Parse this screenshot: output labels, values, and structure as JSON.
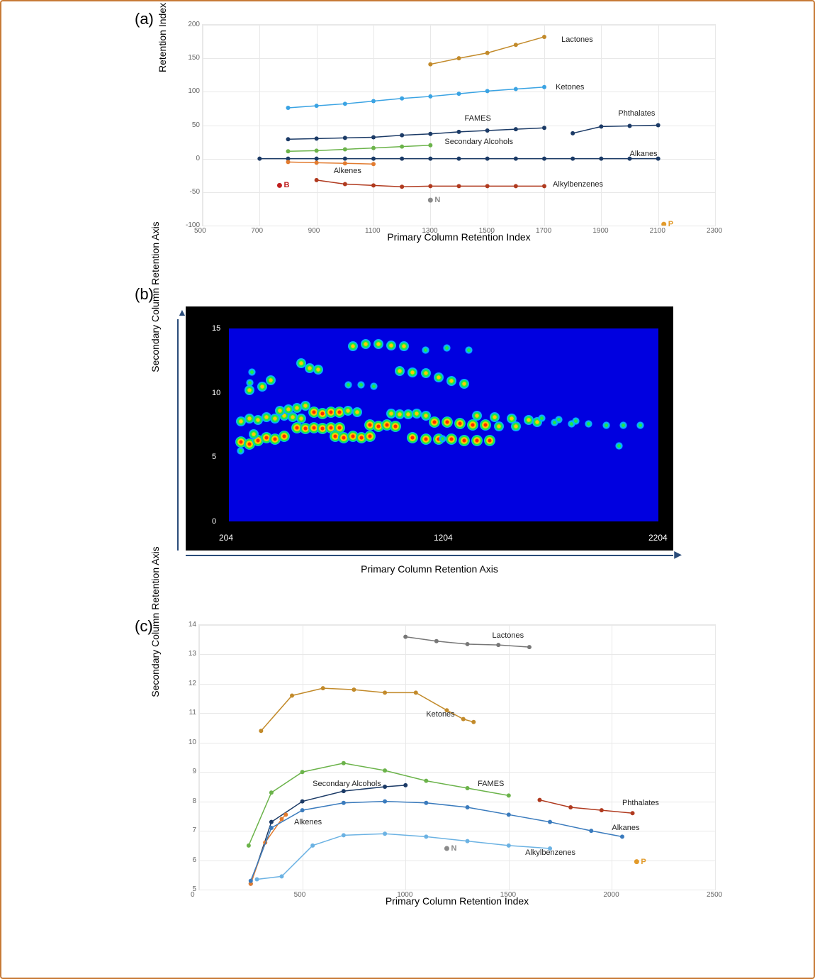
{
  "panel_labels": {
    "a": "(a)",
    "b": "(b)",
    "c": "(c)"
  },
  "axes": {
    "a_x": "Primary Column Retention Index",
    "a_y": "Retention Index Difference (ΔI)",
    "b_x": "Primary Column Retention Axis",
    "b_y": "Secondary Column Retention Axis",
    "c_x": "Primary Column Retention Index",
    "c_y": "Secondary Column Retention Axis"
  },
  "series_names": {
    "lactones": "Lactones",
    "ketones": "Ketones",
    "fames": "FAMES",
    "phthalates": "Phthalates",
    "sec_alc": "Secondary Alcohols",
    "alkanes": "Alkanes",
    "alkenes": "Alkenes",
    "alkylbenz": "Alkylbenzenes"
  },
  "markers": {
    "B": "B",
    "N": "N",
    "P": "P"
  },
  "colors": {
    "lactones": "#c28a2a",
    "ketones": "#3aa3e3",
    "fames": "#1b3a66",
    "phthalates": "#1b3a66",
    "sec_alc": "#6bb34a",
    "alkanes": "#1b3a66",
    "alkenes": "#e27b2f",
    "alkylbenz": "#b03a1f",
    "B": "#c02020",
    "N": "#8a8a8a",
    "P": "#e29a2a",
    "c_lactones": "#777",
    "c_ketones": "#c28a2a",
    "c_fames": "#6bb34a",
    "c_sec_alc": "#1b3a66",
    "c_alkenes": "#e27b2f",
    "c_alkanes": "#3a7bbd",
    "c_alkylbenz": "#6bb2e3",
    "c_phthalates": "#b03a1f"
  },
  "chart_data": [
    {
      "id": "a",
      "type": "line",
      "title": "",
      "xlabel": "Primary Column Retention Index",
      "ylabel": "Retention Index Difference (ΔI)",
      "xlim": [
        500,
        2300
      ],
      "ylim": [
        -100,
        200
      ],
      "xticks": [
        500,
        700,
        900,
        1100,
        1300,
        1500,
        1700,
        1900,
        2100,
        2300
      ],
      "yticks": [
        -100,
        -50,
        0,
        50,
        100,
        150,
        200
      ],
      "series": [
        {
          "name": "Lactones",
          "color": "#c28a2a",
          "x": [
            1300,
            1400,
            1500,
            1600,
            1700
          ],
          "y": [
            141,
            150,
            158,
            170,
            182
          ]
        },
        {
          "name": "Ketones",
          "color": "#3aa3e3",
          "x": [
            800,
            900,
            1000,
            1100,
            1200,
            1300,
            1400,
            1500,
            1600,
            1700
          ],
          "y": [
            76,
            79,
            82,
            86,
            90,
            93,
            97,
            101,
            104,
            107
          ]
        },
        {
          "name": "FAMES",
          "color": "#1b3a66",
          "x": [
            800,
            900,
            1000,
            1100,
            1200,
            1300,
            1400,
            1500,
            1600,
            1700
          ],
          "y": [
            29,
            30,
            31,
            32,
            35,
            37,
            40,
            42,
            44,
            46
          ]
        },
        {
          "name": "Phthalates",
          "color": "#1b3a66",
          "x": [
            1800,
            1900,
            2000,
            2100
          ],
          "y": [
            38,
            48,
            49,
            50
          ]
        },
        {
          "name": "Secondary Alcohols",
          "color": "#6bb34a",
          "x": [
            800,
            900,
            1000,
            1100,
            1200,
            1300
          ],
          "y": [
            11,
            12,
            14,
            16,
            18,
            20
          ]
        },
        {
          "name": "Alkanes",
          "color": "#1b3a66",
          "x": [
            700,
            800,
            900,
            1000,
            1100,
            1200,
            1300,
            1400,
            1500,
            1600,
            1700,
            1800,
            1900,
            2000,
            2100
          ],
          "y": [
            0,
            0,
            0,
            0,
            0,
            0,
            0,
            0,
            0,
            0,
            0,
            0,
            0,
            0,
            0
          ]
        },
        {
          "name": "Alkenes",
          "color": "#e27b2f",
          "x": [
            800,
            900,
            1000,
            1100
          ],
          "y": [
            -5,
            -6,
            -7,
            -8
          ]
        },
        {
          "name": "Alkylbenzenes",
          "color": "#b03a1f",
          "x": [
            900,
            1000,
            1100,
            1200,
            1300,
            1400,
            1500,
            1600,
            1700
          ],
          "y": [
            -32,
            -38,
            -40,
            -42,
            -41,
            -41,
            -41,
            -41,
            -41
          ]
        }
      ],
      "points": [
        {
          "name": "B",
          "color": "#c02020",
          "x": 770,
          "y": -40
        },
        {
          "name": "N",
          "color": "#8a8a8a",
          "x": 1300,
          "y": -62
        },
        {
          "name": "P",
          "color": "#e29a2a",
          "x": 2120,
          "y": -98
        }
      ],
      "annotations": [
        {
          "text": "Lactones",
          "x": 1760,
          "y": 176
        },
        {
          "text": "Ketones",
          "x": 1740,
          "y": 105
        },
        {
          "text": "FAMES",
          "x": 1420,
          "y": 58
        },
        {
          "text": "Phthalates",
          "x": 1960,
          "y": 65
        },
        {
          "text": "Secondary Alcohols",
          "x": 1350,
          "y": 23
        },
        {
          "text": "Alkanes",
          "x": 2000,
          "y": 5
        },
        {
          "text": "Alkenes",
          "x": 960,
          "y": -20
        },
        {
          "text": "Alkylbenzenes",
          "x": 1730,
          "y": -41
        }
      ]
    },
    {
      "id": "b",
      "type": "heatmap",
      "xlabel": "Primary Column Retention Axis",
      "ylabel": "Secondary Column Retention Axis",
      "xlim": [
        204,
        2204
      ],
      "ylim": [
        0,
        15
      ],
      "xticks": [
        204,
        1204,
        2204
      ],
      "yticks": [
        0,
        5,
        10,
        15
      ],
      "spots": [
        [
          260,
          6.2,
          1
        ],
        [
          300,
          6.0,
          1
        ],
        [
          340,
          6.3,
          1
        ],
        [
          320,
          6.8,
          2
        ],
        [
          380,
          6.5,
          1
        ],
        [
          420,
          6.4,
          1
        ],
        [
          460,
          6.6,
          1
        ],
        [
          260,
          7.8,
          2
        ],
        [
          300,
          8.0,
          2
        ],
        [
          340,
          7.9,
          2
        ],
        [
          380,
          8.1,
          2
        ],
        [
          420,
          8.0,
          2
        ],
        [
          460,
          8.2,
          2
        ],
        [
          500,
          8.1,
          2
        ],
        [
          540,
          8.0,
          2
        ],
        [
          300,
          10.2,
          2
        ],
        [
          300,
          10.8,
          3
        ],
        [
          310,
          11.6,
          3
        ],
        [
          360,
          10.5,
          2
        ],
        [
          400,
          11.0,
          2
        ],
        [
          440,
          8.6,
          2
        ],
        [
          480,
          8.7,
          2
        ],
        [
          520,
          8.8,
          2
        ],
        [
          560,
          9.0,
          2
        ],
        [
          520,
          7.3,
          1
        ],
        [
          560,
          7.2,
          1
        ],
        [
          600,
          7.3,
          1
        ],
        [
          640,
          7.2,
          1
        ],
        [
          680,
          7.3,
          1
        ],
        [
          720,
          7.3,
          1
        ],
        [
          540,
          12.3,
          2
        ],
        [
          580,
          11.9,
          2
        ],
        [
          620,
          11.8,
          2
        ],
        [
          600,
          8.5,
          1
        ],
        [
          640,
          8.4,
          1
        ],
        [
          680,
          8.5,
          1
        ],
        [
          720,
          8.5,
          1
        ],
        [
          760,
          8.6,
          2
        ],
        [
          800,
          8.5,
          2
        ],
        [
          700,
          6.6,
          1
        ],
        [
          740,
          6.5,
          1
        ],
        [
          780,
          6.6,
          1
        ],
        [
          820,
          6.5,
          1
        ],
        [
          860,
          6.6,
          1
        ],
        [
          760,
          10.6,
          3
        ],
        [
          820,
          10.6,
          3
        ],
        [
          880,
          10.5,
          3
        ],
        [
          780,
          13.6,
          2
        ],
        [
          840,
          13.8,
          2
        ],
        [
          900,
          13.8,
          2
        ],
        [
          960,
          13.7,
          2
        ],
        [
          1020,
          13.6,
          2
        ],
        [
          1120,
          13.3,
          3
        ],
        [
          1220,
          13.5,
          3
        ],
        [
          1320,
          13.3,
          3
        ],
        [
          860,
          7.5,
          1
        ],
        [
          900,
          7.4,
          1
        ],
        [
          940,
          7.5,
          1
        ],
        [
          980,
          7.4,
          1
        ],
        [
          960,
          8.4,
          2
        ],
        [
          1000,
          8.3,
          2
        ],
        [
          1040,
          8.3,
          2
        ],
        [
          1080,
          8.4,
          2
        ],
        [
          1120,
          8.2,
          2
        ],
        [
          1000,
          11.7,
          2
        ],
        [
          1060,
          11.6,
          2
        ],
        [
          1120,
          11.5,
          2
        ],
        [
          1180,
          11.2,
          2
        ],
        [
          1240,
          10.9,
          2
        ],
        [
          1300,
          10.7,
          2
        ],
        [
          1060,
          6.5,
          1
        ],
        [
          1120,
          6.4,
          1
        ],
        [
          1180,
          6.4,
          1
        ],
        [
          1240,
          6.4,
          1
        ],
        [
          1300,
          6.3,
          1
        ],
        [
          1360,
          6.3,
          1
        ],
        [
          1420,
          6.3,
          1
        ],
        [
          1160,
          7.7,
          1
        ],
        [
          1220,
          7.7,
          1
        ],
        [
          1280,
          7.6,
          1
        ],
        [
          1340,
          7.5,
          1
        ],
        [
          1400,
          7.5,
          1
        ],
        [
          1460,
          7.4,
          2
        ],
        [
          1540,
          7.4,
          2
        ],
        [
          1360,
          8.2,
          2
        ],
        [
          1440,
          8.1,
          2
        ],
        [
          1520,
          8.0,
          2
        ],
        [
          1600,
          7.9,
          2
        ],
        [
          1640,
          7.7,
          2
        ],
        [
          1720,
          7.7,
          3
        ],
        [
          1800,
          7.6,
          3
        ],
        [
          1880,
          7.6,
          3
        ],
        [
          1960,
          7.5,
          3
        ],
        [
          2040,
          7.5,
          3
        ],
        [
          2120,
          7.5,
          3
        ],
        [
          1660,
          8.0,
          3
        ],
        [
          1740,
          7.9,
          3
        ],
        [
          1820,
          7.8,
          3
        ],
        [
          260,
          5.5,
          3
        ],
        [
          1200,
          6.4,
          3
        ],
        [
          2020,
          5.9,
          3
        ]
      ]
    },
    {
      "id": "c",
      "type": "line",
      "xlabel": "Primary Column Retention Index",
      "ylabel": "Secondary Column Retention Axis",
      "xlim": [
        0,
        2500
      ],
      "ylim": [
        5.0,
        14.0
      ],
      "xticks": [
        0,
        500,
        1000,
        1500,
        2000,
        2500
      ],
      "yticks": [
        5.0,
        6.0,
        7.0,
        8.0,
        9.0,
        10.0,
        11.0,
        12.0,
        13.0,
        14.0
      ],
      "series": [
        {
          "name": "Lactones",
          "color": "#777",
          "x": [
            1000,
            1150,
            1300,
            1450,
            1600
          ],
          "y": [
            13.6,
            13.45,
            13.35,
            13.32,
            13.25
          ]
        },
        {
          "name": "Ketones",
          "color": "#c28a2a",
          "x": [
            300,
            450,
            600,
            750,
            900,
            1050,
            1200,
            1280,
            1330
          ],
          "y": [
            10.4,
            11.6,
            11.85,
            11.8,
            11.7,
            11.7,
            11.1,
            10.8,
            10.7
          ]
        },
        {
          "name": "FAMES",
          "color": "#6bb34a",
          "x": [
            240,
            350,
            500,
            700,
            900,
            1100,
            1300,
            1500
          ],
          "y": [
            6.5,
            8.3,
            9.0,
            9.3,
            9.05,
            8.7,
            8.45,
            8.2
          ]
        },
        {
          "name": "Secondary Alcohols",
          "color": "#1b3a66",
          "x": [
            250,
            350,
            500,
            700,
            900,
            1000
          ],
          "y": [
            5.2,
            7.3,
            8.0,
            8.35,
            8.5,
            8.55
          ]
        },
        {
          "name": "Alkenes",
          "color": "#e27b2f",
          "x": [
            250,
            320,
            400,
            420
          ],
          "y": [
            5.2,
            6.6,
            7.4,
            7.55
          ]
        },
        {
          "name": "Alkanes",
          "color": "#3a7bbd",
          "x": [
            250,
            350,
            500,
            700,
            900,
            1100,
            1300,
            1500,
            1700,
            1900,
            2050
          ],
          "y": [
            5.3,
            7.1,
            7.7,
            7.95,
            8.0,
            7.95,
            7.8,
            7.55,
            7.3,
            7.0,
            6.8
          ]
        },
        {
          "name": "Alkylbenzenes",
          "color": "#6bb2e3",
          "x": [
            280,
            400,
            550,
            700,
            900,
            1100,
            1300,
            1500,
            1700
          ],
          "y": [
            5.35,
            5.45,
            6.5,
            6.85,
            6.9,
            6.8,
            6.65,
            6.5,
            6.4
          ]
        },
        {
          "name": "Phthalates",
          "color": "#b03a1f",
          "x": [
            1650,
            1800,
            1950,
            2100
          ],
          "y": [
            8.05,
            7.8,
            7.7,
            7.6
          ]
        }
      ],
      "points": [
        {
          "name": "N",
          "color": "#8a8a8a",
          "x": 1200,
          "y": 6.4
        },
        {
          "name": "P",
          "color": "#e29a2a",
          "x": 2120,
          "y": 5.95
        }
      ],
      "annotations": [
        {
          "text": "Lactones",
          "x": 1420,
          "y": 13.6
        },
        {
          "text": "Ketones",
          "x": 1100,
          "y": 10.9
        },
        {
          "text": "Secondary Alcohols",
          "x": 550,
          "y": 8.55
        },
        {
          "text": "FAMES",
          "x": 1350,
          "y": 8.55
        },
        {
          "text": "Phthalates",
          "x": 2050,
          "y": 7.9
        },
        {
          "text": "Alkanes",
          "x": 2000,
          "y": 7.05
        },
        {
          "text": "Alkenes",
          "x": 460,
          "y": 7.25
        },
        {
          "text": "Alkylbenzenes",
          "x": 1580,
          "y": 6.2
        }
      ]
    }
  ],
  "b_axis_ticks": {
    "x": [
      "204",
      "1204",
      "2204"
    ],
    "y": [
      "0",
      "5",
      "10",
      "15"
    ]
  }
}
